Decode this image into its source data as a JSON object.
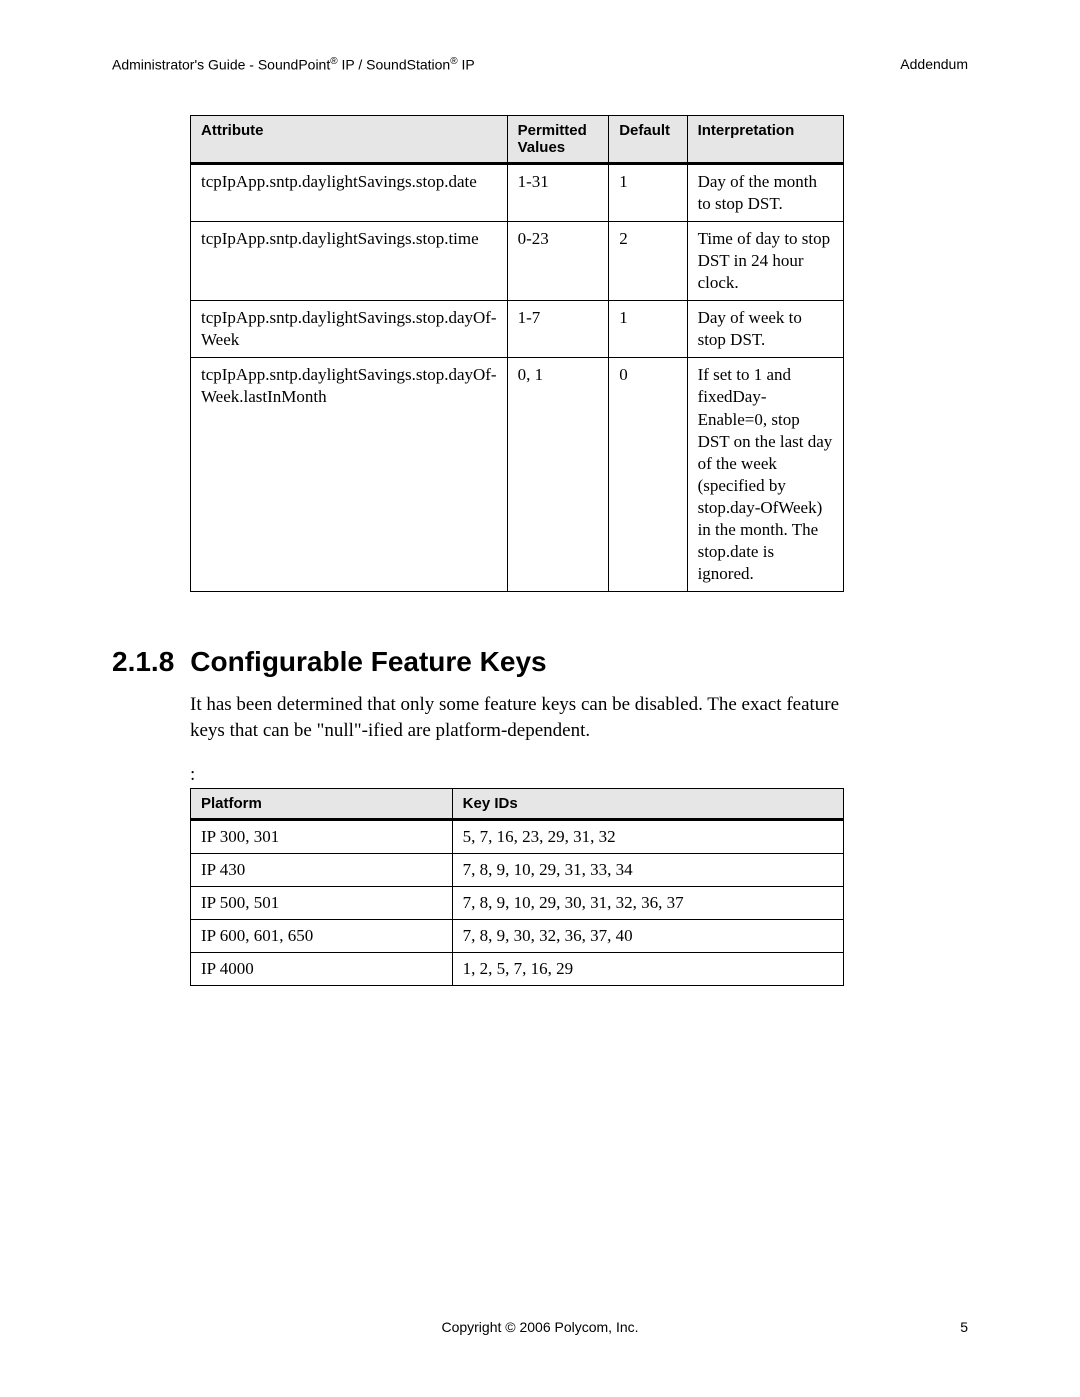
{
  "header": {
    "left_prefix": "Administrator's Guide - SoundPoint",
    "left_mid": " IP / SoundStation",
    "left_suffix": " IP",
    "reg": "®",
    "right": "Addendum"
  },
  "table1": {
    "headers": {
      "attribute": "Attribute",
      "permitted": "Permitted Values",
      "default": "Default",
      "interpretation": "Interpretation"
    },
    "rows": [
      {
        "attribute": "tcpIpApp.sntp.daylightSavings.stop.date",
        "permitted": "1-31",
        "default": "1",
        "interpretation": "Day of the month to stop DST."
      },
      {
        "attribute": "tcpIpApp.sntp.daylightSavings.stop.time",
        "permitted": "0-23",
        "default": "2",
        "interpretation": "Time of day to stop DST in 24 hour clock."
      },
      {
        "attribute": "tcpIpApp.sntp.daylightSavings.stop.dayOf-Week",
        "permitted": "1-7",
        "default": "1",
        "interpretation": "Day of week to stop DST."
      },
      {
        "attribute": "tcpIpApp.sntp.daylightSavings.stop.dayOf-Week.lastInMonth",
        "permitted": "0, 1",
        "default": "0",
        "interpretation": "If set to 1 and fixedDay-Enable=0, stop DST on the last day of the week (specified by stop.day-OfWeek) in the month. The stop.date is ignored."
      }
    ]
  },
  "section": {
    "num": "2.1.8",
    "title": "Configurable Feature Keys",
    "body": "It has been determined that only some feature keys can be disabled. The exact feature keys that can be \"null\"-ified are platform-dependent.",
    "colon": ":"
  },
  "table2": {
    "headers": {
      "platform": "Platform",
      "keyids": "Key IDs"
    },
    "rows": [
      {
        "platform": "IP 300, 301",
        "keyids": "5, 7, 16, 23, 29, 31, 32"
      },
      {
        "platform": "IP 430",
        "keyids": "7, 8, 9, 10, 29, 31, 33, 34"
      },
      {
        "platform": "IP 500, 501",
        "keyids": "7, 8, 9, 10, 29, 30, 31, 32, 36, 37"
      },
      {
        "platform": "IP 600, 601, 650",
        "keyids": "7, 8, 9, 30, 32, 36, 37, 40"
      },
      {
        "platform": "IP 4000",
        "keyids": "1, 2, 5, 7, 16, 29"
      }
    ]
  },
  "footer": {
    "copyright": "Copyright © 2006 Polycom, Inc.",
    "page": "5"
  }
}
